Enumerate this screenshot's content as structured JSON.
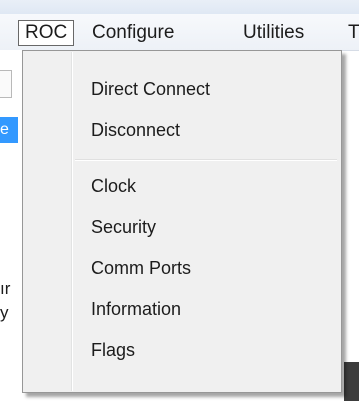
{
  "menubar": {
    "items": [
      {
        "label": "ROC"
      },
      {
        "label": "Configure"
      },
      {
        "label": "Utilities"
      },
      {
        "label": "T"
      }
    ]
  },
  "background": {
    "selected_fragment": "e",
    "fragments": [
      "ır",
      "y"
    ]
  },
  "dropdown": {
    "groups": [
      {
        "items": [
          "Direct Connect",
          "Disconnect"
        ]
      },
      {
        "items": [
          "Clock",
          "Security",
          "Comm Ports",
          "Information",
          "Flags"
        ]
      }
    ]
  }
}
